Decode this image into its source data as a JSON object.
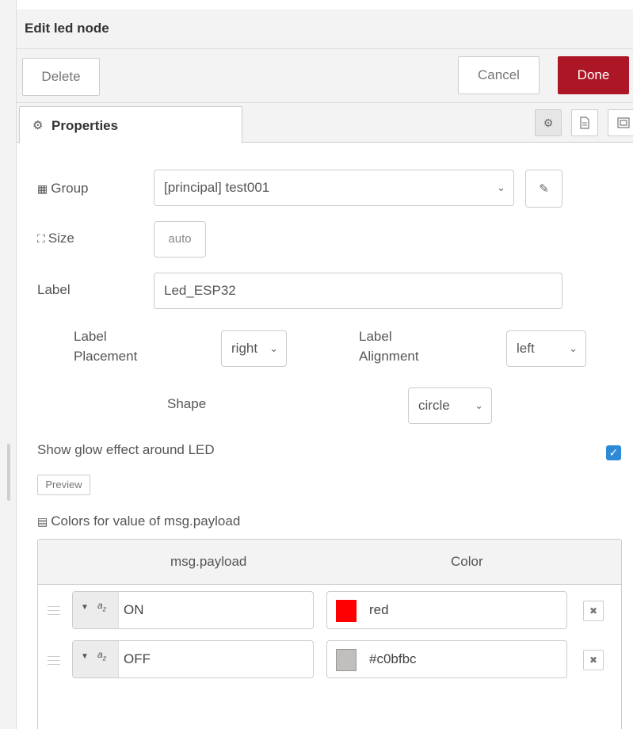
{
  "dialog": {
    "title": "Edit led node"
  },
  "toolbar": {
    "delete_label": "Delete",
    "cancel_label": "Cancel",
    "done_label": "Done"
  },
  "tabs": {
    "properties_label": "Properties"
  },
  "form": {
    "group": {
      "label": "Group",
      "value": "[principal] test001"
    },
    "size": {
      "label": "Size",
      "value": "auto"
    },
    "label": {
      "label": "Label",
      "value": "Led_ESP32"
    },
    "label_placement": {
      "label_line1": "Label",
      "label_line2": "Placement",
      "value": "right"
    },
    "label_alignment": {
      "label_line1": "Label",
      "label_line2": "Alignment",
      "value": "left"
    },
    "shape": {
      "label": "Shape",
      "value": "circle"
    },
    "glow": {
      "label": "Show glow effect around LED",
      "checked": true
    },
    "preview_label": "Preview",
    "colors_label": "Colors for value of msg.payload"
  },
  "colors_table": {
    "headers": [
      "msg.payload",
      "Color"
    ],
    "rows": [
      {
        "value": "ON",
        "color_text": "red",
        "swatch": "#ff0000"
      },
      {
        "value": "OFF",
        "color_text": "#c0bfbc",
        "swatch": "#c0bfbc"
      }
    ]
  },
  "colors": {
    "done_button": "#ad1625",
    "checkbox": "#2d8ad6"
  }
}
